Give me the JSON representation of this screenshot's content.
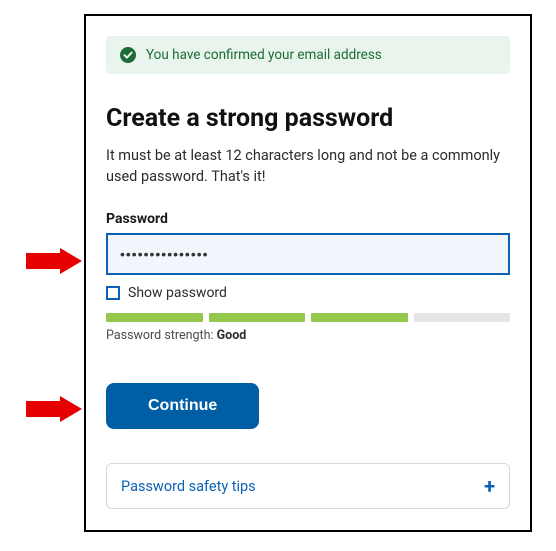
{
  "alert": {
    "message": "You have confirmed your email address",
    "icon": "check-circle"
  },
  "heading": "Create a strong password",
  "description": "It must be at least 12 characters long and not be a commonly used password. That's it!",
  "password": {
    "label": "Password",
    "value_masked": "•••••••••••••••",
    "show_checkbox_label": "Show password",
    "show_checked": false
  },
  "strength": {
    "prefix": "Password strength: ",
    "value": "Good",
    "segments_filled": 3,
    "segments_total": 4
  },
  "continue_label": "Continue",
  "tips": {
    "label": "Password safety tips",
    "expanded": false
  },
  "colors": {
    "accent_blue": "#005EA5",
    "link_blue": "#0B62B4",
    "success_green": "#1C6B36",
    "success_bg": "#E9F5EC",
    "strength_green": "#94C84C",
    "arrow_red": "#E60000"
  }
}
